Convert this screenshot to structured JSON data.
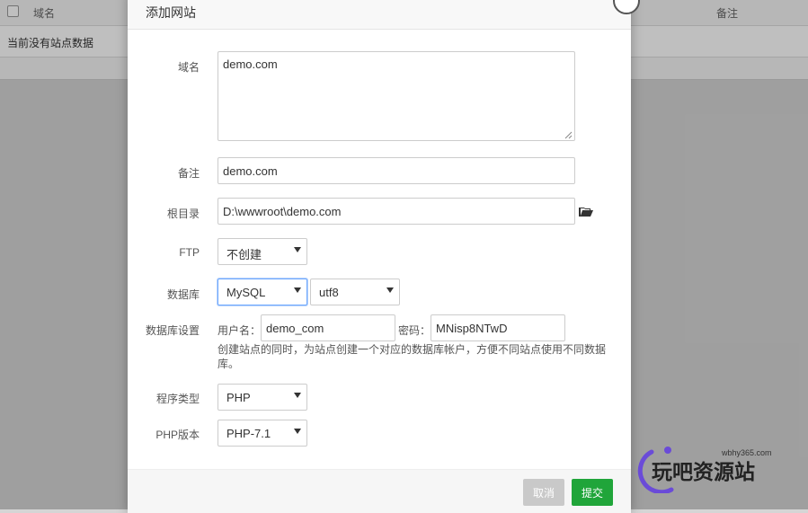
{
  "background": {
    "columns": [
      "域名",
      "备注"
    ],
    "empty_message": "当前没有站点数据"
  },
  "dialog": {
    "title": "添加网站",
    "fields": {
      "domain": {
        "label": "域名",
        "value": "demo.com"
      },
      "remark": {
        "label": "备注",
        "value": "demo.com"
      },
      "root": {
        "label": "根目录",
        "value": "D:\\wwwroot\\demo.com"
      },
      "ftp": {
        "label": "FTP",
        "value": "不创建"
      },
      "database": {
        "label": "数据库",
        "type": "MySQL",
        "charset": "utf8"
      },
      "db_settings": {
        "label": "数据库设置",
        "username_label": "用户名：",
        "username": "demo_com",
        "password_label": "密码：",
        "password": "MNisp8NTwD",
        "hint": "创建站点的同时，为站点创建一个对应的数据库帐户，方便不同站点使用不同数据库。"
      },
      "program": {
        "label": "程序类型",
        "value": "PHP"
      },
      "php_version": {
        "label": "PHP版本",
        "value": "PHP-7.1"
      }
    },
    "buttons": {
      "cancel": "取消",
      "submit": "提交"
    }
  },
  "watermark": {
    "url": "wbhy365.com",
    "name": "玩吧资源站"
  },
  "icons": {
    "folder": "folder-open-icon",
    "close": "close-icon",
    "dropdown": "chevron-down-icon",
    "checkbox": "checkbox-icon"
  },
  "colors": {
    "submit": "#20a53a",
    "cancel": "#c9c9c9",
    "focus": "#6ea8fe",
    "watermark": "#6a4bd8"
  }
}
